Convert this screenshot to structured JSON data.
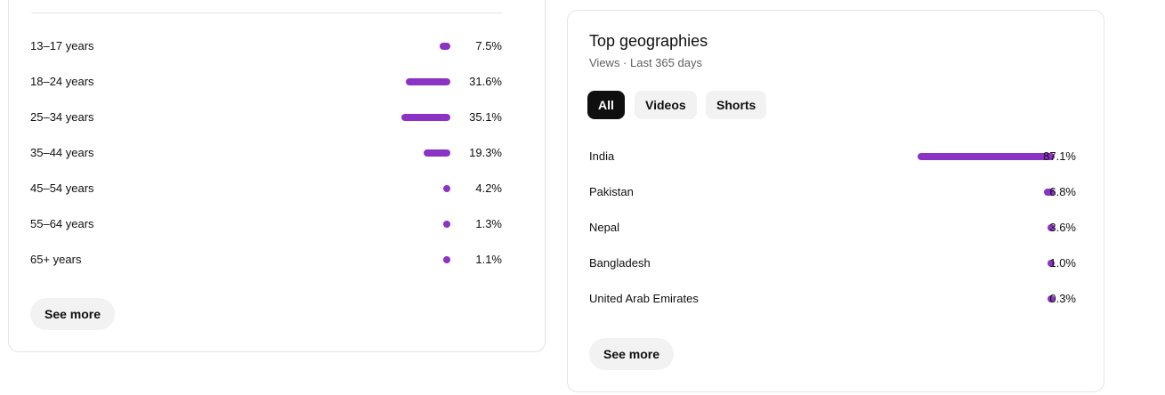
{
  "colors": {
    "bar": "#8a33c4",
    "chip_active_bg": "#0f0f0f",
    "chip_inactive_bg": "#f2f2f2",
    "button_bg": "#f2f2f2"
  },
  "age": {
    "rows": [
      {
        "label": "13–17 years",
        "value": "7.5%",
        "fraction": 0.075
      },
      {
        "label": "18–24 years",
        "value": "31.6%",
        "fraction": 0.316
      },
      {
        "label": "25–34 years",
        "value": "35.1%",
        "fraction": 0.351
      },
      {
        "label": "35–44 years",
        "value": "19.3%",
        "fraction": 0.193
      },
      {
        "label": "45–54 years",
        "value": "4.2%",
        "fraction": 0.042
      },
      {
        "label": "55–64 years",
        "value": "1.3%",
        "fraction": 0.013
      },
      {
        "label": "65+ years",
        "value": "1.1%",
        "fraction": 0.011
      }
    ],
    "see_more_label": "See more"
  },
  "geo": {
    "title": "Top geographies",
    "subtitle": "Views · Last 365 days",
    "chips": [
      {
        "label": "All",
        "active": true
      },
      {
        "label": "Videos",
        "active": false
      },
      {
        "label": "Shorts",
        "active": false
      }
    ],
    "rows": [
      {
        "label": "India",
        "value": "87.1%",
        "fraction": 0.871
      },
      {
        "label": "Pakistan",
        "value": "6.8%",
        "fraction": 0.068
      },
      {
        "label": "Nepal",
        "value": "3.6%",
        "fraction": 0.036
      },
      {
        "label": "Bangladesh",
        "value": "1.0%",
        "fraction": 0.01
      },
      {
        "label": "United Arab Emirates",
        "value": "0.3%",
        "fraction": 0.003
      }
    ],
    "see_more_label": "See more"
  }
}
